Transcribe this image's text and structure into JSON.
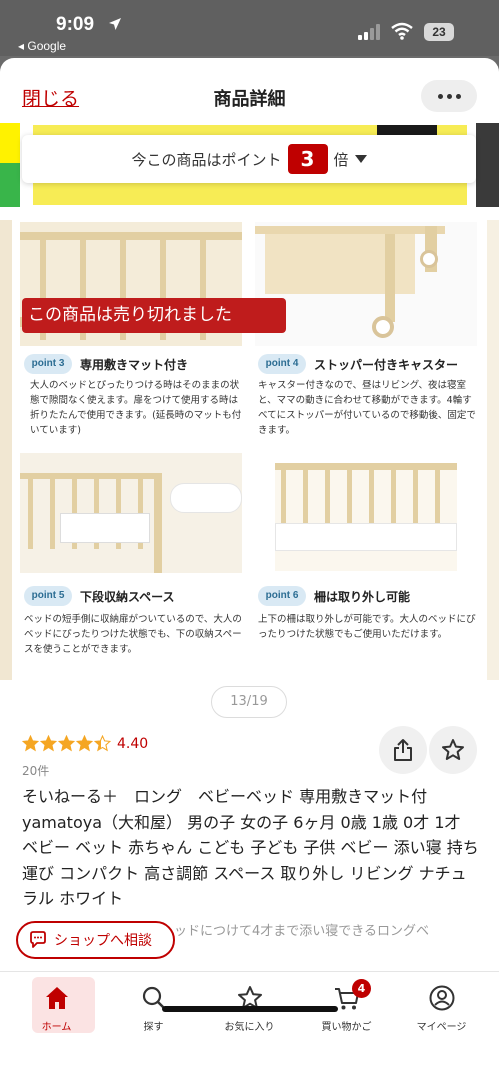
{
  "status_bar": {
    "time": "9:09",
    "back_app": "◂ Google",
    "battery": "23"
  },
  "header": {
    "close_label": "閉じる",
    "title": "商品詳細"
  },
  "points_banner": {
    "prefix": "今この商品はポイント",
    "multiplier": "3",
    "suffix": "倍"
  },
  "product_image": {
    "sold_out": "この商品は売り切れました",
    "features": [
      {
        "badge": "point 3",
        "title": "専用敷きマット付き",
        "desc": "大人のベッドとぴったりつける時はそのままの状態で隙間なく使えます。扉をつけて使用する時は折りたたんで使用できます。(延長時のマットも付いています)"
      },
      {
        "badge": "point 4",
        "title": "ストッパー付きキャスター",
        "desc": "キャスター付きなので、昼はリビング、夜は寝室と、ママの動きに合わせて移動ができます。4輪すべてにストッパーが付いているので移動後、固定できます。"
      },
      {
        "badge": "point 5",
        "title": "下段収納スペース",
        "desc": "ベッドの短手側に収納扉がついているので、大人のベッドにぴったりつけた状態でも、下の収納スペースを使うことができます。"
      },
      {
        "badge": "point 6",
        "title": "柵は取り外し可能",
        "desc": "上下の柵は取り外しが可能です。大人のベッドにぴったりつけた状態でもご使用いただけます。"
      }
    ]
  },
  "pager": {
    "text": "13/19",
    "current": 13,
    "total": 19
  },
  "rating": {
    "value": "4.40",
    "stars": 4.4,
    "review_count": "20件"
  },
  "product": {
    "name": "そいねーる＋　ロング　ベビーベッド 専用敷きマット付 yamatoya（大和屋） 男の子 女の子 6ヶ月 0歳 1歳 0才 1才 ベビー ベット 赤ちゃん こども 子ども 子供 ベビー 添い寝 持ち運び コンパクト 高さ調節 スペース 取り外し リビング ナチュラル ホワイト",
    "subtitle": "ッドにつけて4才まで添い寝できるロングベ"
  },
  "shop_button": {
    "label": "ショップへ相談"
  },
  "bottom_nav": {
    "items": [
      {
        "label": "ホーム",
        "icon": "home-icon"
      },
      {
        "label": "探す",
        "icon": "search-icon"
      },
      {
        "label": "お気に入り",
        "icon": "star-icon"
      },
      {
        "label": "買い物かご",
        "icon": "cart-icon"
      },
      {
        "label": "マイページ",
        "icon": "user-icon"
      }
    ],
    "cart_count": "4"
  },
  "colors": {
    "accent": "#bf0000",
    "star": "#f5a623"
  }
}
